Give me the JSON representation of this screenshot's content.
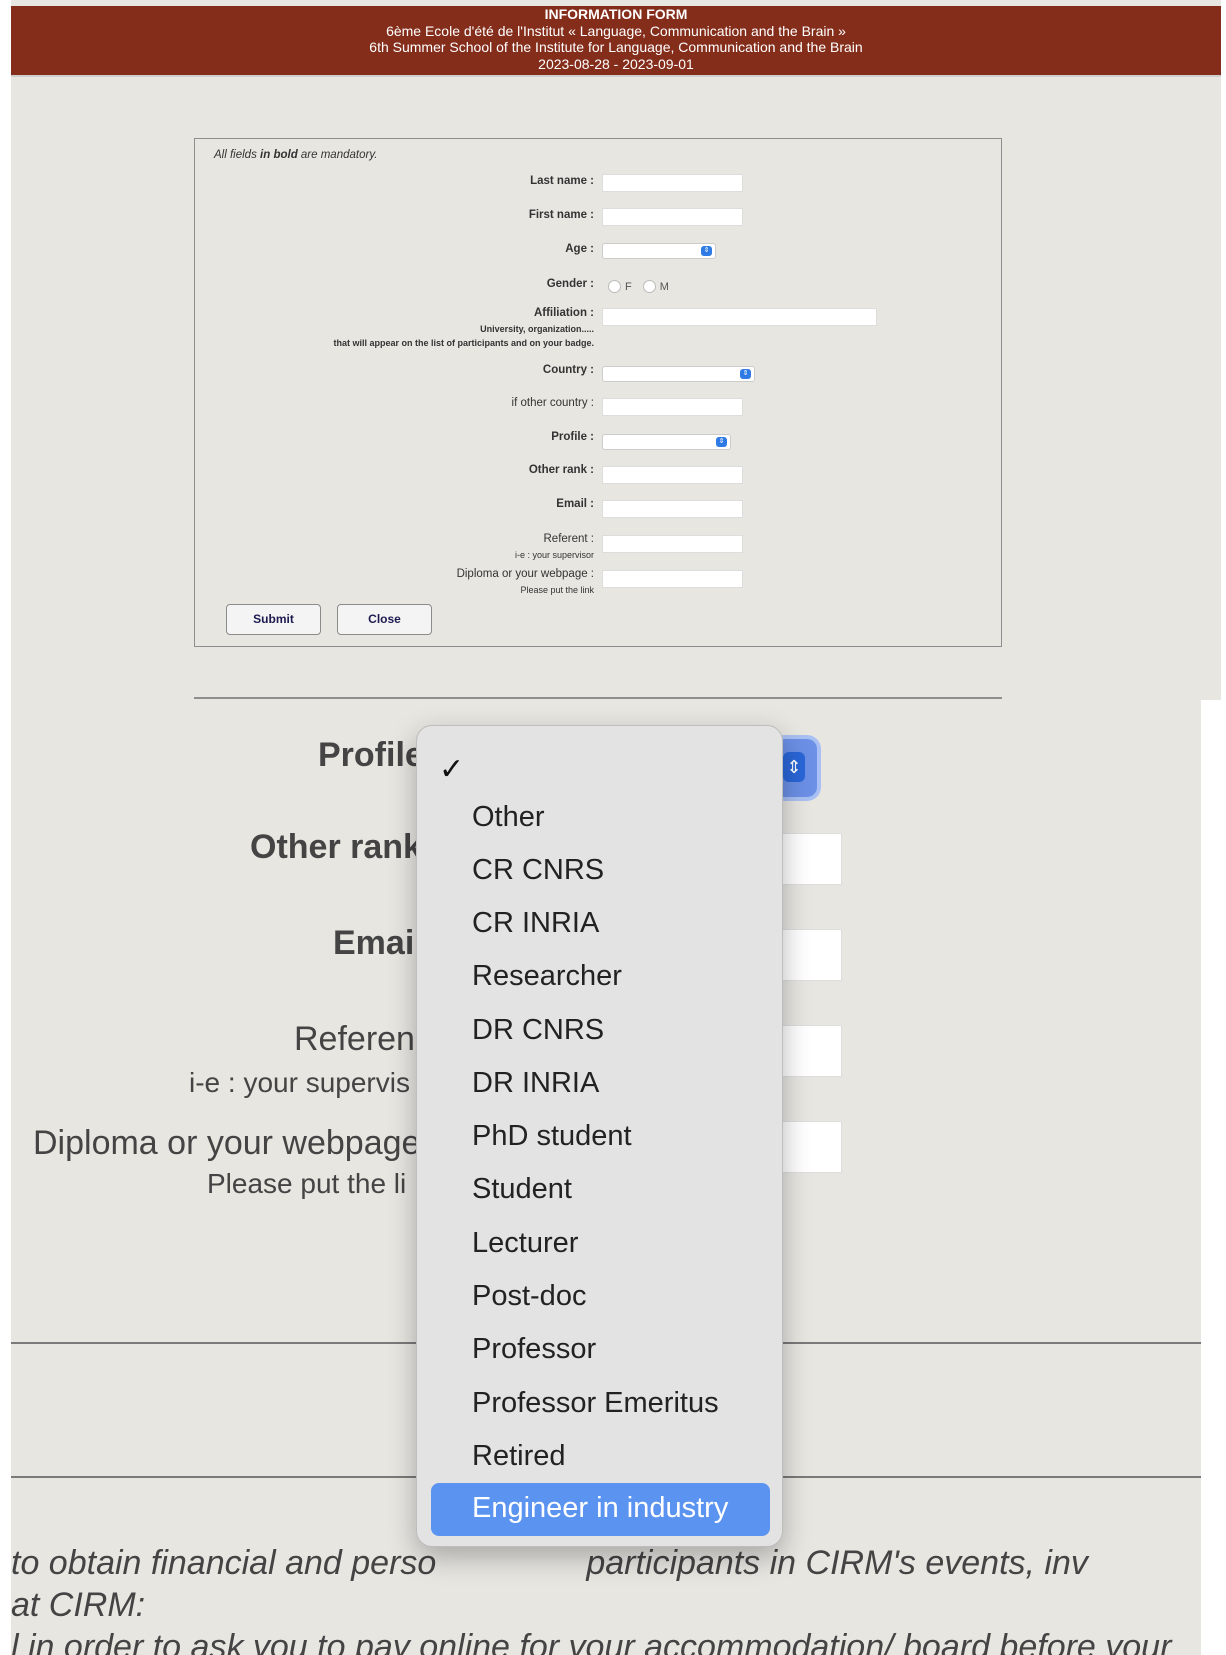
{
  "header": {
    "title": "INFORMATION FORM",
    "line_fr": "6ème Ecole d'été de l'Institut « Language, Communication and the Brain »",
    "line_en": "6th Summer School of the Institute for Language, Communication and the Brain",
    "dates": "2023-08-28 - 2023-09-01",
    "color": "#842d1b"
  },
  "form": {
    "mandatory_note_pre": "All fields ",
    "mandatory_note_bold": "in bold",
    "mandatory_note_post": " are mandatory.",
    "last_name_label": "Last name :",
    "first_name_label": "First name :",
    "age_label": "Age :",
    "gender_label": "Gender :",
    "gender_f": "F",
    "gender_m": "M",
    "affiliation_label": "Affiliation :",
    "affiliation_hint1": "University, organization.....",
    "affiliation_hint2": "that will appear on the list of participants and on your badge.",
    "country_label": "Country :",
    "other_country_label": "if other country :",
    "profile_label": "Profile :",
    "other_rank_label": "Other rank :",
    "email_label": "Email :",
    "referent_label": "Referent :",
    "referent_hint": "i-e : your supervisor",
    "diploma_label": "Diploma or your webpage :",
    "diploma_hint": "Please put the link",
    "submit_label": "Submit",
    "close_label": "Close"
  },
  "zoom": {
    "profile_label": "Profile",
    "other_rank_label": "Other rank",
    "email_label": "Emai",
    "referent_label": "Referen",
    "referent_hint": "i-e : your supervis",
    "diploma_label": "Diploma or your webpage",
    "diploma_hint": "Please put the li",
    "para_line1a": "to obtain financial and perso",
    "para_line1b": "participants in CIRM's events, inv",
    "para_line2": "at CIRM:",
    "para_line3": "l in order to ask you to pay online for your accommodation/ board before your"
  },
  "profile_menu": {
    "selected_check": "✓",
    "options": [
      "Other",
      "CR CNRS",
      "CR INRIA",
      "Researcher",
      "DR CNRS",
      "DR INRIA",
      "PhD student",
      "Student",
      "Lecturer",
      "Post-doc",
      "Professor",
      "Professor Emeritus",
      "Retired"
    ],
    "highlighted": "Engineer in industry",
    "highlight_color": "#5b93f0"
  }
}
